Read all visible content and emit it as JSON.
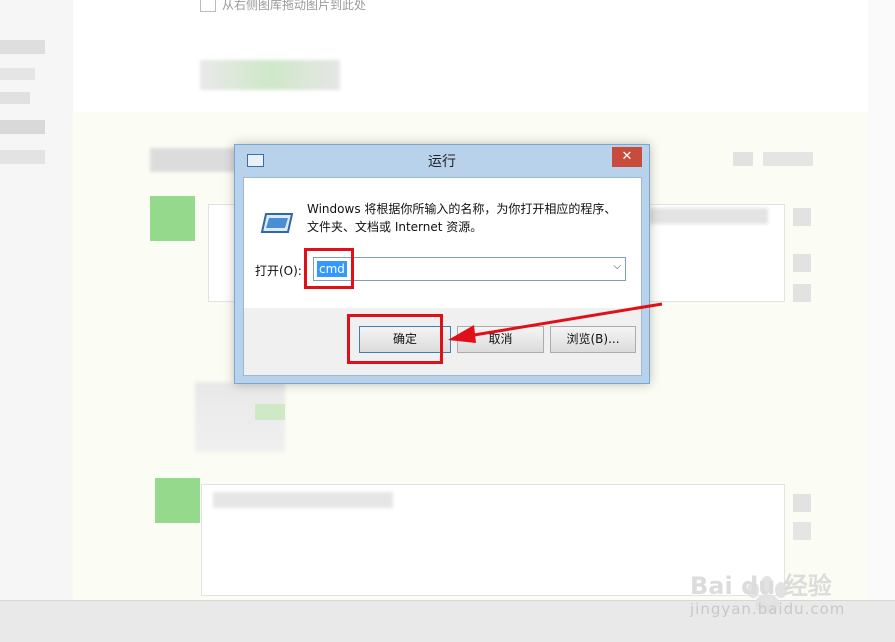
{
  "background": {
    "top_hint": "从右侧图库拖动图片到此处"
  },
  "dialog": {
    "title": "运行",
    "close_glyph": "✕",
    "description_line1": "Windows 将根据你所输入的名称，为你打开相应的程序、",
    "description_line2": "文件夹、文档或 Internet 资源。",
    "open_label": "打开(O):",
    "open_value": "cmd",
    "buttons": {
      "ok": "确定",
      "cancel": "取消",
      "browse": "浏览(B)..."
    }
  },
  "watermark": {
    "brand": "Bai du 经验",
    "url": "jingyan.baidu.com"
  },
  "colors": {
    "accent_red": "#e0101a",
    "selection_blue": "#3399ff",
    "title_bar": "#b7d2ea",
    "close_button": "#c74c3c"
  },
  "icons": [
    "image-icon",
    "run-program-icon",
    "close-icon",
    "dropdown-chevron-icon",
    "pointer-arrow",
    "baidu-paw-icon"
  ]
}
